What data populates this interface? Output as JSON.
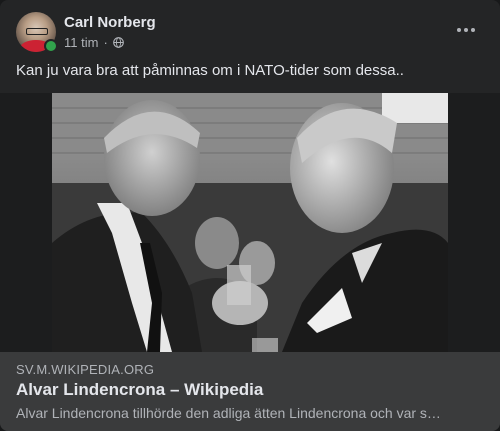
{
  "post": {
    "author_name": "Carl Norberg",
    "time": "11 tim",
    "audience_icon": "globe-icon",
    "more_icon": "more-horizontal-icon",
    "text": "Kan ju vara bra att påminnas om i NATO-tider som dessa.."
  },
  "link": {
    "domain": "SV.M.WIKIPEDIA.ORG",
    "title": "Alvar Lindencrona – Wikipedia",
    "description": "Alvar Lindencrona tillhörde den adliga ätten Lindencrona och var s…"
  },
  "colors": {
    "card_bg": "#242526",
    "preview_bg": "#3a3b3c",
    "primary_text": "#e4e6eb",
    "secondary_text": "#b0b3b8",
    "online": "#31a24c"
  }
}
